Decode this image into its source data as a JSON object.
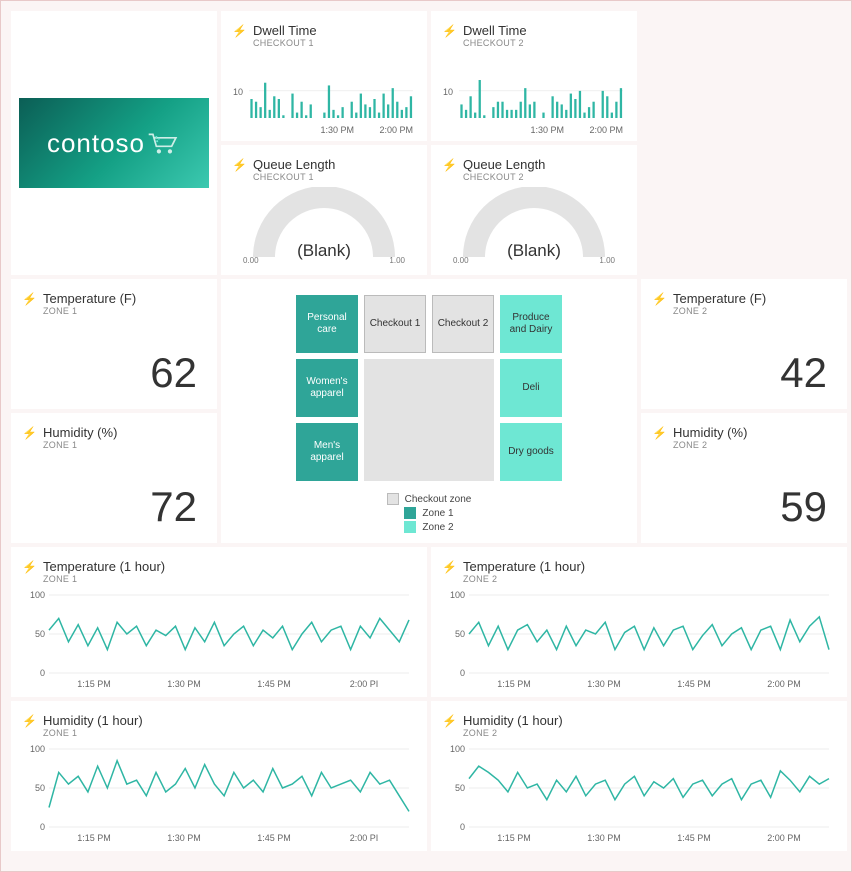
{
  "brand": {
    "name": "contoso"
  },
  "colors": {
    "zone1": "#2fa598",
    "zone2": "#6ee7d3",
    "checkout": "#e3e3e3",
    "accent": "#2fb6a4"
  },
  "dwell1": {
    "title": "Dwell Time",
    "sub": "CHECKOUT 1",
    "ymax": 10,
    "ticks": [
      "1:30 PM",
      "2:00 PM"
    ]
  },
  "dwell2": {
    "title": "Dwell Time",
    "sub": "CHECKOUT 2",
    "ymax": 10,
    "ticks": [
      "1:30 PM",
      "2:00 PM"
    ]
  },
  "queue1": {
    "title": "Queue Length",
    "sub": "CHECKOUT 1",
    "value": "(Blank)",
    "min": "0.00",
    "max": "1.00"
  },
  "queue2": {
    "title": "Queue Length",
    "sub": "CHECKOUT 2",
    "value": "(Blank)",
    "min": "0.00",
    "max": "1.00"
  },
  "temp1": {
    "title": "Temperature (F)",
    "sub": "ZONE 1",
    "value": "62"
  },
  "temp2": {
    "title": "Temperature (F)",
    "sub": "ZONE 2",
    "value": "42"
  },
  "hum1": {
    "title": "Humidity (%)",
    "sub": "ZONE 1",
    "value": "72"
  },
  "hum2": {
    "title": "Humidity (%)",
    "sub": "ZONE 2",
    "value": "59"
  },
  "map": {
    "tiles": {
      "personal_care": "Personal care",
      "checkout1": "Checkout 1",
      "checkout2": "Checkout 2",
      "produce": "Produce and Dairy",
      "womens": "Women's apparel",
      "deli": "Deli",
      "mens": "Men's apparel",
      "dry": "Dry goods"
    },
    "legend": {
      "checkout": "Checkout zone",
      "z1": "Zone 1",
      "z2": "Zone 2"
    }
  },
  "tline1": {
    "title": "Temperature (1 hour)",
    "sub": "ZONE 1"
  },
  "tline2": {
    "title": "Temperature (1 hour)",
    "sub": "ZONE 2"
  },
  "hline1": {
    "title": "Humidity (1 hour)",
    "sub": "ZONE 1"
  },
  "hline2": {
    "title": "Humidity (1 hour)",
    "sub": "ZONE 2"
  },
  "line_axis": {
    "ymin": 0,
    "ymid": 50,
    "ymax": 100,
    "xticks": [
      "1:15 PM",
      "1:30 PM",
      "1:45 PM",
      "2:00 PM"
    ],
    "xticks_short": [
      "1:15 PM",
      "1:30 PM",
      "1:45 PM",
      "2:00 PI"
    ]
  },
  "chart_data": [
    {
      "id": "dwell1",
      "type": "bar",
      "title": "Dwell Time — Checkout 1",
      "ylabel": "",
      "ylim": [
        0,
        14
      ],
      "values": [
        7,
        6,
        4,
        13,
        3,
        8,
        7,
        1,
        0,
        9,
        2,
        6,
        1,
        5,
        0,
        0,
        2,
        12,
        3,
        1,
        4,
        0,
        6,
        2,
        9,
        5,
        4,
        7,
        2,
        9,
        5,
        11,
        6,
        3,
        4,
        8
      ]
    },
    {
      "id": "dwell2",
      "type": "bar",
      "title": "Dwell Time — Checkout 2",
      "ylabel": "",
      "ylim": [
        0,
        14
      ],
      "values": [
        5,
        3,
        8,
        2,
        14,
        1,
        0,
        4,
        6,
        6,
        3,
        3,
        3,
        6,
        11,
        5,
        6,
        0,
        2,
        0,
        8,
        6,
        5,
        3,
        9,
        7,
        10,
        2,
        4,
        6,
        0,
        10,
        8,
        2,
        6,
        11
      ]
    },
    {
      "id": "queue1",
      "type": "gauge",
      "title": "Queue Length — Checkout 1",
      "range": [
        0,
        1
      ],
      "value": null
    },
    {
      "id": "queue2",
      "type": "gauge",
      "title": "Queue Length — Checkout 2",
      "range": [
        0,
        1
      ],
      "value": null
    },
    {
      "id": "tline1",
      "type": "line",
      "title": "Temperature (1 hour) — Zone 1",
      "ylim": [
        0,
        100
      ],
      "xticks": [
        "1:15 PM",
        "1:30 PM",
        "1:45 PM",
        "2:00 PM"
      ],
      "values": [
        55,
        70,
        40,
        62,
        35,
        58,
        30,
        65,
        50,
        60,
        35,
        55,
        48,
        60,
        30,
        58,
        40,
        65,
        35,
        50,
        60,
        35,
        55,
        45,
        60,
        30,
        50,
        65,
        40,
        55,
        60,
        30,
        60,
        45,
        70,
        55,
        40,
        68
      ]
    },
    {
      "id": "tline2",
      "type": "line",
      "title": "Temperature (1 hour) — Zone 2",
      "ylim": [
        0,
        100
      ],
      "xticks": [
        "1:15 PM",
        "1:30 PM",
        "1:45 PM",
        "2:00 PM"
      ],
      "values": [
        50,
        65,
        35,
        60,
        30,
        55,
        62,
        40,
        55,
        30,
        60,
        35,
        55,
        50,
        65,
        30,
        52,
        60,
        30,
        58,
        35,
        55,
        60,
        30,
        48,
        62,
        35,
        50,
        58,
        30,
        55,
        60,
        30,
        68,
        40,
        60,
        72,
        30
      ]
    },
    {
      "id": "hline1",
      "type": "line",
      "title": "Humidity (1 hour) — Zone 1",
      "ylim": [
        0,
        100
      ],
      "xticks": [
        "1:15 PM",
        "1:30 PM",
        "1:45 PM",
        "2:00 PM"
      ],
      "values": [
        25,
        70,
        55,
        65,
        45,
        78,
        50,
        85,
        55,
        60,
        40,
        70,
        45,
        55,
        75,
        50,
        80,
        55,
        40,
        70,
        50,
        60,
        45,
        75,
        50,
        55,
        65,
        40,
        70,
        50,
        55,
        60,
        45,
        70,
        55,
        60,
        40,
        20
      ]
    },
    {
      "id": "hline2",
      "type": "line",
      "title": "Humidity (1 hour) — Zone 2",
      "ylim": [
        0,
        100
      ],
      "xticks": [
        "1:15 PM",
        "1:30 PM",
        "1:45 PM",
        "2:00 PM"
      ],
      "values": [
        62,
        78,
        70,
        60,
        45,
        70,
        50,
        55,
        35,
        60,
        45,
        65,
        40,
        55,
        60,
        35,
        55,
        65,
        40,
        58,
        50,
        62,
        38,
        55,
        60,
        40,
        55,
        62,
        35,
        55,
        60,
        38,
        72,
        60,
        45,
        65,
        55,
        62
      ]
    }
  ]
}
